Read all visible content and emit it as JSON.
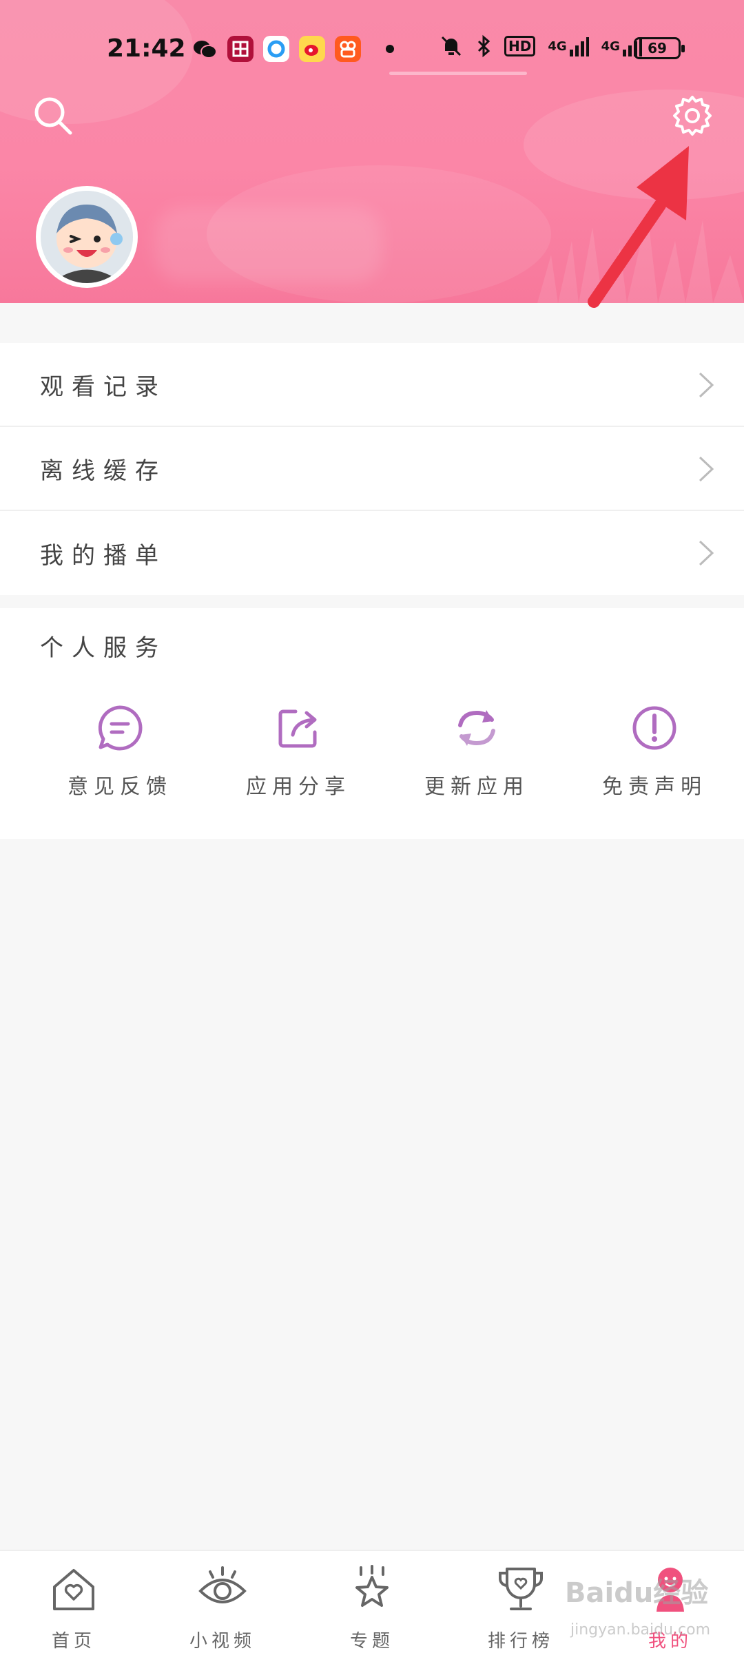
{
  "status_bar": {
    "time": "21:42",
    "battery": "69",
    "hd_label": "HD",
    "net_1": "4G",
    "net_2": "4G",
    "app_icons": [
      "wechat-icon",
      "app-store-icon",
      "browser-icon",
      "weibo-icon",
      "kuaishou-icon"
    ]
  },
  "header": {
    "search_icon": "search-icon",
    "settings_icon": "gear-icon",
    "accent": "#f98aa9"
  },
  "menu": {
    "items": [
      {
        "label": "观看记录"
      },
      {
        "label": "离线缓存"
      },
      {
        "label": "我的播单"
      }
    ]
  },
  "services": {
    "title": "个人服务",
    "items": [
      {
        "label": "意见反馈",
        "icon": "feedback-icon"
      },
      {
        "label": "应用分享",
        "icon": "share-icon"
      },
      {
        "label": "更新应用",
        "icon": "update-icon"
      },
      {
        "label": "免责声明",
        "icon": "disclaimer-icon"
      }
    ],
    "icon_color": "#b06cc0"
  },
  "bottom_nav": {
    "items": [
      {
        "label": "首页",
        "icon": "home-icon"
      },
      {
        "label": "小视频",
        "icon": "eye-icon"
      },
      {
        "label": "专题",
        "icon": "star-icon"
      },
      {
        "label": "排行榜",
        "icon": "trophy-icon"
      },
      {
        "label": "我的",
        "icon": "profile-icon",
        "active": true
      }
    ],
    "active_color": "#f0517e"
  },
  "watermark": {
    "text": "Baidu经验",
    "url": "jingyan.baidu.com"
  }
}
